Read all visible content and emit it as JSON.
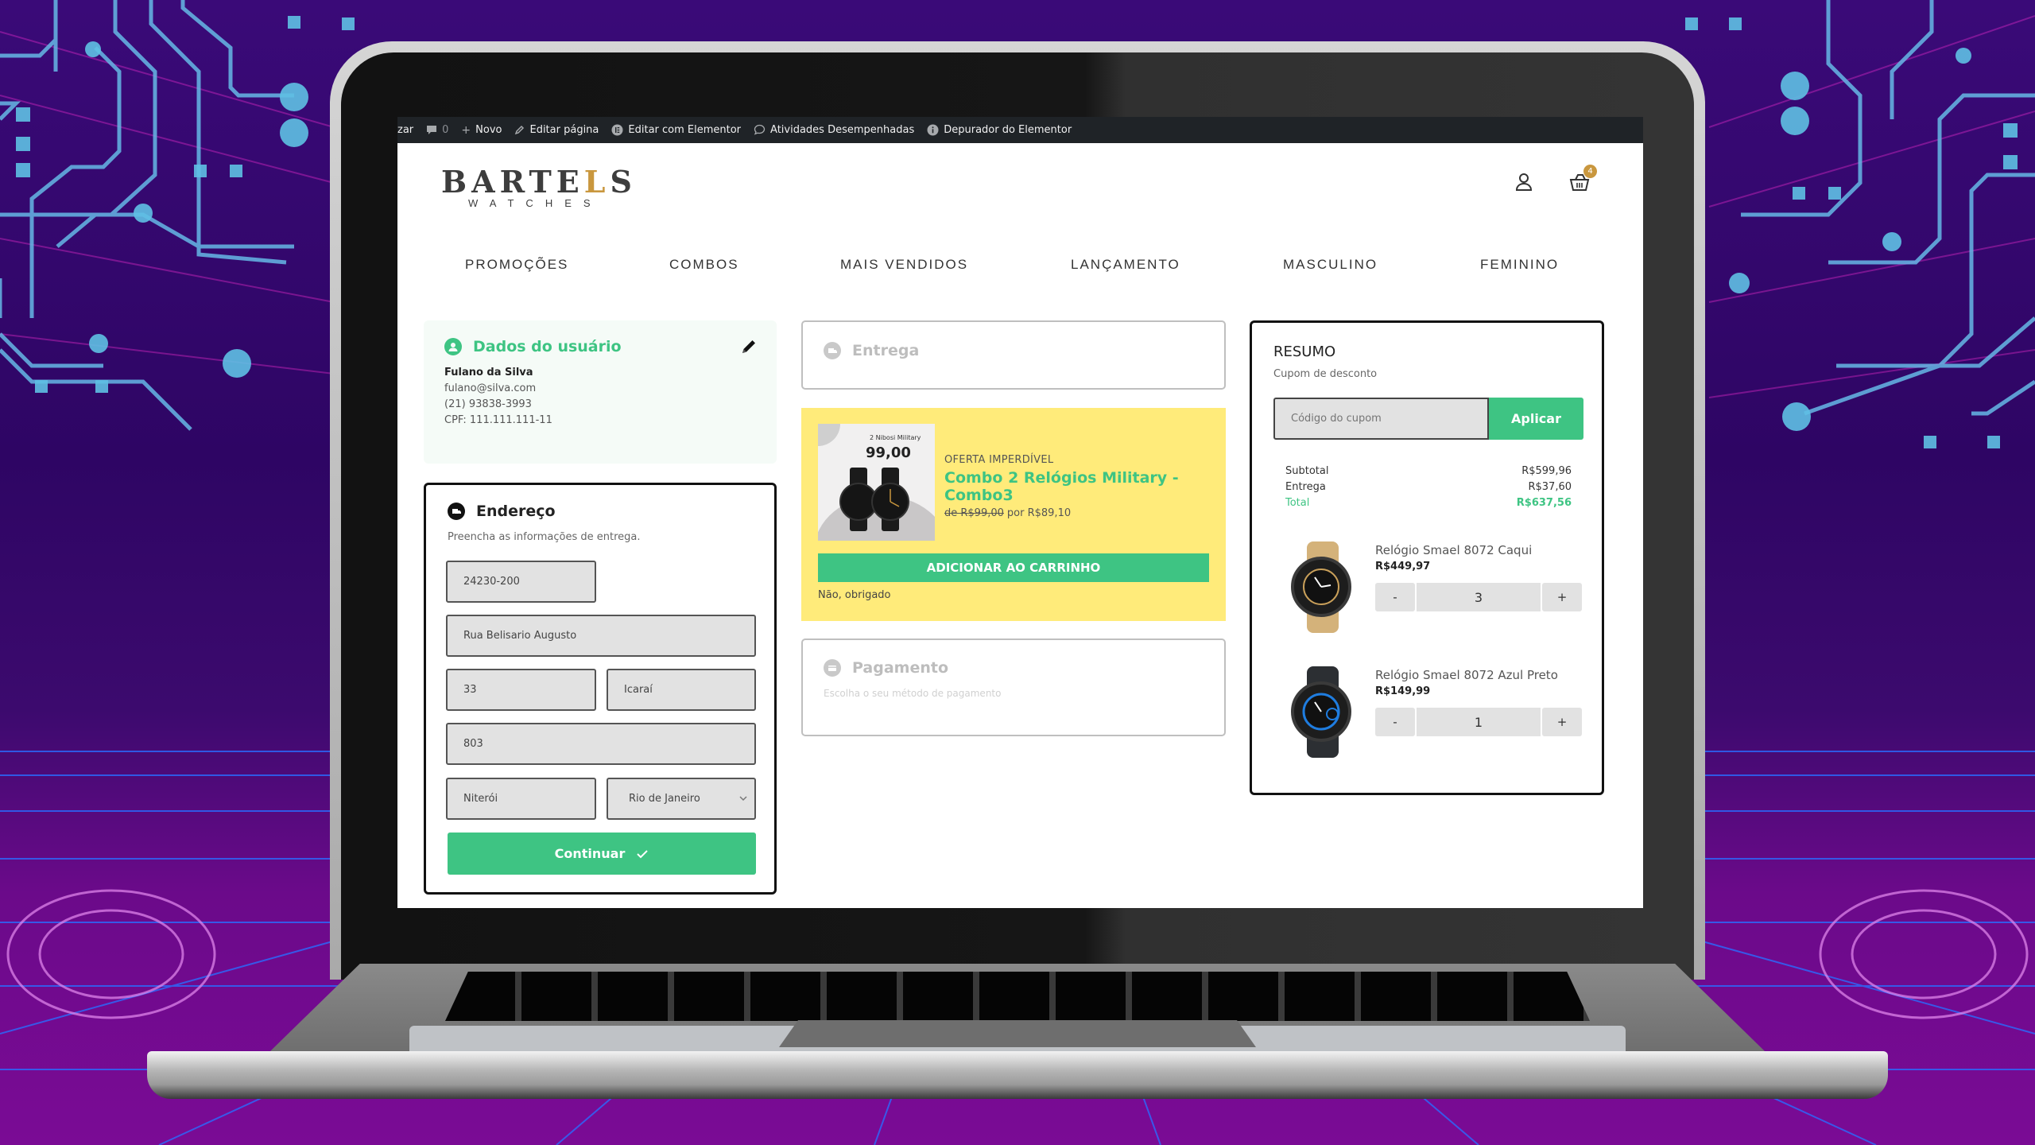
{
  "admin_bar": {
    "items": [
      {
        "label": "zar",
        "icon": "truncated"
      },
      {
        "label": "0",
        "icon": "comment-icon"
      },
      {
        "label": "Novo",
        "icon": "plus-icon"
      },
      {
        "label": "Editar página",
        "icon": "pencil-icon"
      },
      {
        "label": "Editar com Elementor",
        "icon": "elementor-icon"
      },
      {
        "label": "Atividades Desempenhadas",
        "icon": "chat-bubble-icon"
      },
      {
        "label": "Depurador do Elementor",
        "icon": "info-icon"
      }
    ]
  },
  "header": {
    "logo_main_pre": "BARTE",
    "logo_main_accent": "L",
    "logo_main_post": "S",
    "logo_sub": "WATCHES",
    "cart_count": "4",
    "accent_color": "#c9973e"
  },
  "nav": {
    "items": [
      "PROMOÇÕES",
      "COMBOS",
      "MAIS VENDIDOS",
      "LANÇAMENTO",
      "MASCULINO",
      "FEMININO"
    ]
  },
  "user_panel": {
    "title": "Dados do usuário",
    "name": "Fulano da Silva",
    "email": "fulano@silva.com",
    "phone": "(21) 93838-3993",
    "cpf": "CPF: 111.111.111-11"
  },
  "address": {
    "title": "Endereço",
    "subtitle": "Preencha as informações de entrega.",
    "cep": "24230-200",
    "street": "Rua Belisario Augusto",
    "number": "33",
    "neighborhood": "Icaraí",
    "complement": "803",
    "city": "Niterói",
    "state": "Rio de Janeiro",
    "continue_label": "Continuar"
  },
  "delivery": {
    "title": "Entrega"
  },
  "offer": {
    "image_heading": "2 Nibosi Military",
    "image_price": "99,00",
    "tag": "OFERTA IMPERDÍVEL",
    "title": "Combo 2 Relógios Military - Combo3",
    "old_price": "de R$99,00",
    "new_price": "por R$89,10",
    "add_label": "ADICIONAR AO CARRINHO",
    "decline_label": "Não, obrigado"
  },
  "payment": {
    "title": "Pagamento",
    "subtitle": "Escolha o seu método de pagamento"
  },
  "summary": {
    "title": "RESUMO",
    "coupon_label": "Cupom de desconto",
    "coupon_placeholder": "Código do cupom",
    "apply_label": "Aplicar",
    "rows": [
      {
        "label": "Subtotal",
        "value": "R$599,96"
      },
      {
        "label": "Entrega",
        "value": "R$37,60"
      },
      {
        "label": "Total",
        "value": "R$637,56"
      }
    ],
    "items": [
      {
        "name": "Relógio Smael 8072 Caqui",
        "price": "R$449,97",
        "qty": "3",
        "strap_color": "#d4b27a",
        "accent": "#c9a05a"
      },
      {
        "name": "Relógio Smael 8072 Azul Preto",
        "price": "R$149,99",
        "qty": "1",
        "strap_color": "#2c2f33",
        "accent": "#1f7de0"
      }
    ],
    "minus_label": "-",
    "plus_label": "+"
  },
  "colors": {
    "primary_green": "#3ec483",
    "offer_yellow": "#ffeb7a",
    "admin_bar": "#1f2327"
  }
}
